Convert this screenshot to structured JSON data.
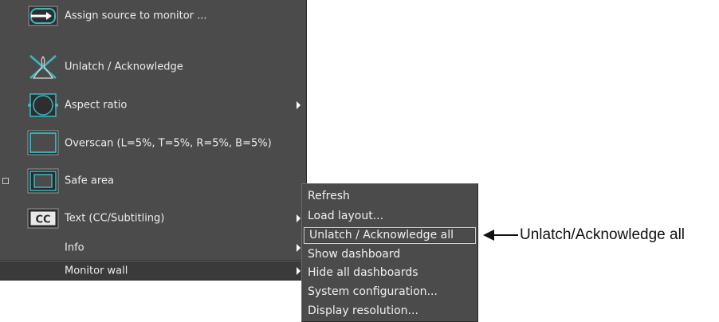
{
  "menu": {
    "items": [
      {
        "label": "Assign source to monitor ...",
        "icon": "assign-source-icon",
        "submenu": false
      },
      {
        "label": "Unlatch / Acknowledge",
        "icon": "unlatch-acknowledge-icon",
        "submenu": false
      },
      {
        "label": "Aspect ratio",
        "icon": "aspect-ratio-icon",
        "submenu": true
      },
      {
        "label": "Overscan (L=5%, T=5%, R=5%, B=5%)",
        "icon": "overscan-icon",
        "submenu": false
      },
      {
        "label": "Safe area",
        "icon": "safe-area-icon",
        "submenu": false,
        "checked": false
      },
      {
        "label": "Text (CC/Subtitling)",
        "icon": "cc-icon",
        "icon_text": "CC",
        "submenu": true
      },
      {
        "label": "Info",
        "submenu": true
      },
      {
        "label": "Monitor wall",
        "submenu": true,
        "selected": true
      }
    ]
  },
  "submenu": {
    "items": [
      {
        "label": "Refresh"
      },
      {
        "label": "Load layout..."
      },
      {
        "label": "Unlatch / Acknowledge all",
        "highlighted": true
      },
      {
        "label": "Show dashboard"
      },
      {
        "label": "Hide all dashboards"
      },
      {
        "label": "System configuration..."
      },
      {
        "label": "Display resolution..."
      }
    ]
  },
  "callout": {
    "text": "Unlatch/Acknowledge all"
  },
  "colors": {
    "menu_bg": "#4b4b4b",
    "icon_accent": "#3fb6c0",
    "text": "#ececec"
  }
}
